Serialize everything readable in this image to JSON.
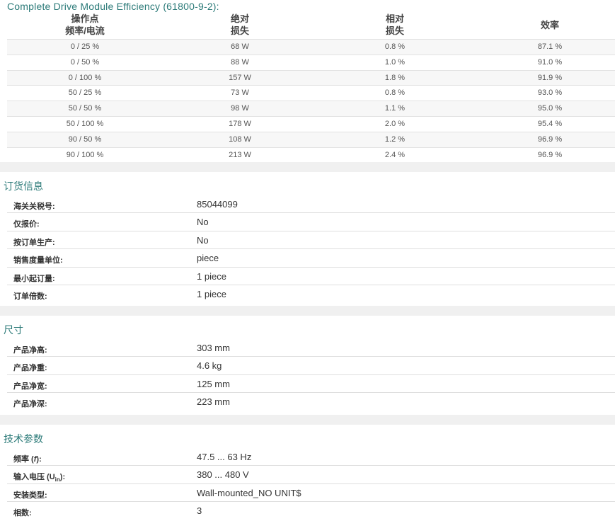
{
  "efficiency": {
    "title": "Complete Drive Module Efficiency (61800-9-2):",
    "headers": {
      "op_line1": "操作点",
      "op_line2": "频率/电流",
      "abs_line1": "绝对",
      "abs_line2": "损失",
      "rel_line1": "相对",
      "rel_line2": "损失",
      "eff": "效率"
    },
    "rows": [
      {
        "op": "0 / 25 %",
        "abs": "68 W",
        "rel": "0.8 %",
        "eff": "87.1 %"
      },
      {
        "op": "0 / 50 %",
        "abs": "88 W",
        "rel": "1.0 %",
        "eff": "91.0 %"
      },
      {
        "op": "0 / 100 %",
        "abs": "157 W",
        "rel": "1.8 %",
        "eff": "91.9 %"
      },
      {
        "op": "50 / 25 %",
        "abs": "73 W",
        "rel": "0.8 %",
        "eff": "93.0 %"
      },
      {
        "op": "50 / 50 %",
        "abs": "98 W",
        "rel": "1.1 %",
        "eff": "95.0 %"
      },
      {
        "op": "50 / 100 %",
        "abs": "178 W",
        "rel": "2.0 %",
        "eff": "95.4 %"
      },
      {
        "op": "90 / 50 %",
        "abs": "108 W",
        "rel": "1.2 %",
        "eff": "96.9 %"
      },
      {
        "op": "90 / 100 %",
        "abs": "213 W",
        "rel": "2.4 %",
        "eff": "96.9 %"
      }
    ]
  },
  "ordering": {
    "title": "订货信息",
    "rows": [
      {
        "key": "海关关税号:",
        "value": "85044099"
      },
      {
        "key": "仅报价:",
        "value": "No"
      },
      {
        "key": "按订单生产:",
        "value": "No"
      },
      {
        "key": "销售度量单位:",
        "value": "piece"
      },
      {
        "key": "最小起订量:",
        "value": "1 piece"
      },
      {
        "key": "订单倍数:",
        "value": "1 piece"
      }
    ]
  },
  "dimensions": {
    "title": "尺寸",
    "rows": [
      {
        "key": "产品净高:",
        "value": "303 mm"
      },
      {
        "key": "产品净重:",
        "value": "4.6 kg"
      },
      {
        "key": "产品净宽:",
        "value": "125 mm"
      },
      {
        "key": "产品净深:",
        "value": "223 mm"
      }
    ]
  },
  "technical": {
    "title": "技术参数",
    "rows": [
      {
        "key_prefix": "频率 (",
        "key_italic": "f",
        "key_suffix": "):",
        "value": "47.5 ... 63 Hz"
      },
      {
        "key_prefix": "输入电压 (U",
        "key_sub": "in",
        "key_suffix": "):",
        "value": "380 ... 480 V"
      },
      {
        "key": "安装类型:",
        "value": "Wall-mounted_NO UNIT$"
      },
      {
        "key": "相数:",
        "value": "3"
      }
    ]
  }
}
